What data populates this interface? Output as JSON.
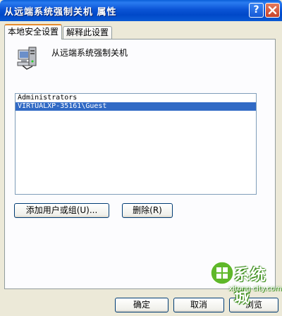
{
  "window": {
    "title": "从远端系统强制关机 属性",
    "help_glyph": "?",
    "colors": {
      "titlebar": "#0b54d6",
      "face": "#ece9d8",
      "selection": "#316ac5",
      "tab_accent": "#e68b2c"
    }
  },
  "tabs": [
    {
      "label": "本地安全设置",
      "active": true
    },
    {
      "label": "解释此设置",
      "active": false
    }
  ],
  "policy": {
    "name": "从远端系统强制关机",
    "icon": "computer-policy-icon"
  },
  "users_list": {
    "items": [
      {
        "label": "Administrators",
        "selected": false
      },
      {
        "label": "VIRTUALXP-35161\\Guest",
        "selected": true
      }
    ]
  },
  "buttons": {
    "add": "添加用户或组(U)...",
    "remove": "删除(R)",
    "ok": "确定",
    "cancel": "取消",
    "browse": "浏览"
  },
  "watermark": {
    "text": "系统城",
    "url": "xitong city.com",
    "icon": "windows-flag-icon"
  }
}
